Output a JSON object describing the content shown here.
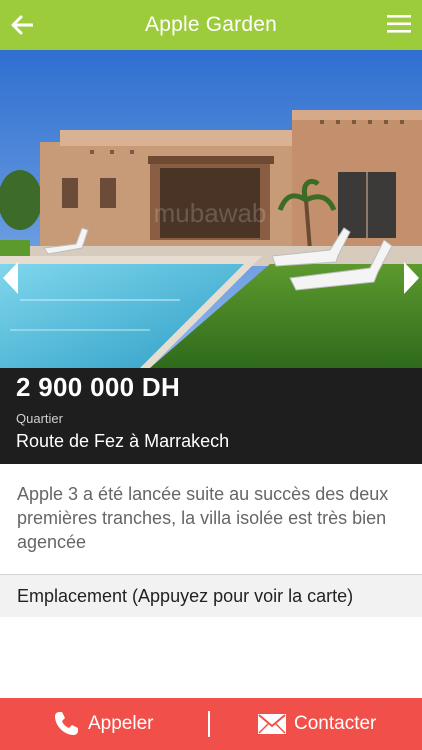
{
  "header": {
    "title": "Apple Garden",
    "back_icon": "arrow-left-icon",
    "menu_icon": "hamburger-menu-icon"
  },
  "gallery": {
    "prev_icon": "chevron-left-icon",
    "next_icon": "chevron-right-icon"
  },
  "listing": {
    "price": "2 900 000 DH",
    "district_label": "Quartier",
    "district_value": "Route de Fez à Marrakech",
    "description": "Apple 3 a été lancée suite au succès des deux premières tranches, la villa isolée est très bien agencée",
    "location_label": "Emplacement (Appuyez pour voir la carte)"
  },
  "actions": {
    "call_label": "Appeler",
    "call_icon": "phone-icon",
    "contact_label": "Contacter",
    "contact_icon": "envelope-icon"
  },
  "colors": {
    "header_bg": "#9ccc3c",
    "info_bg": "#1e1e1e",
    "action_bar_bg": "#f1504a"
  }
}
